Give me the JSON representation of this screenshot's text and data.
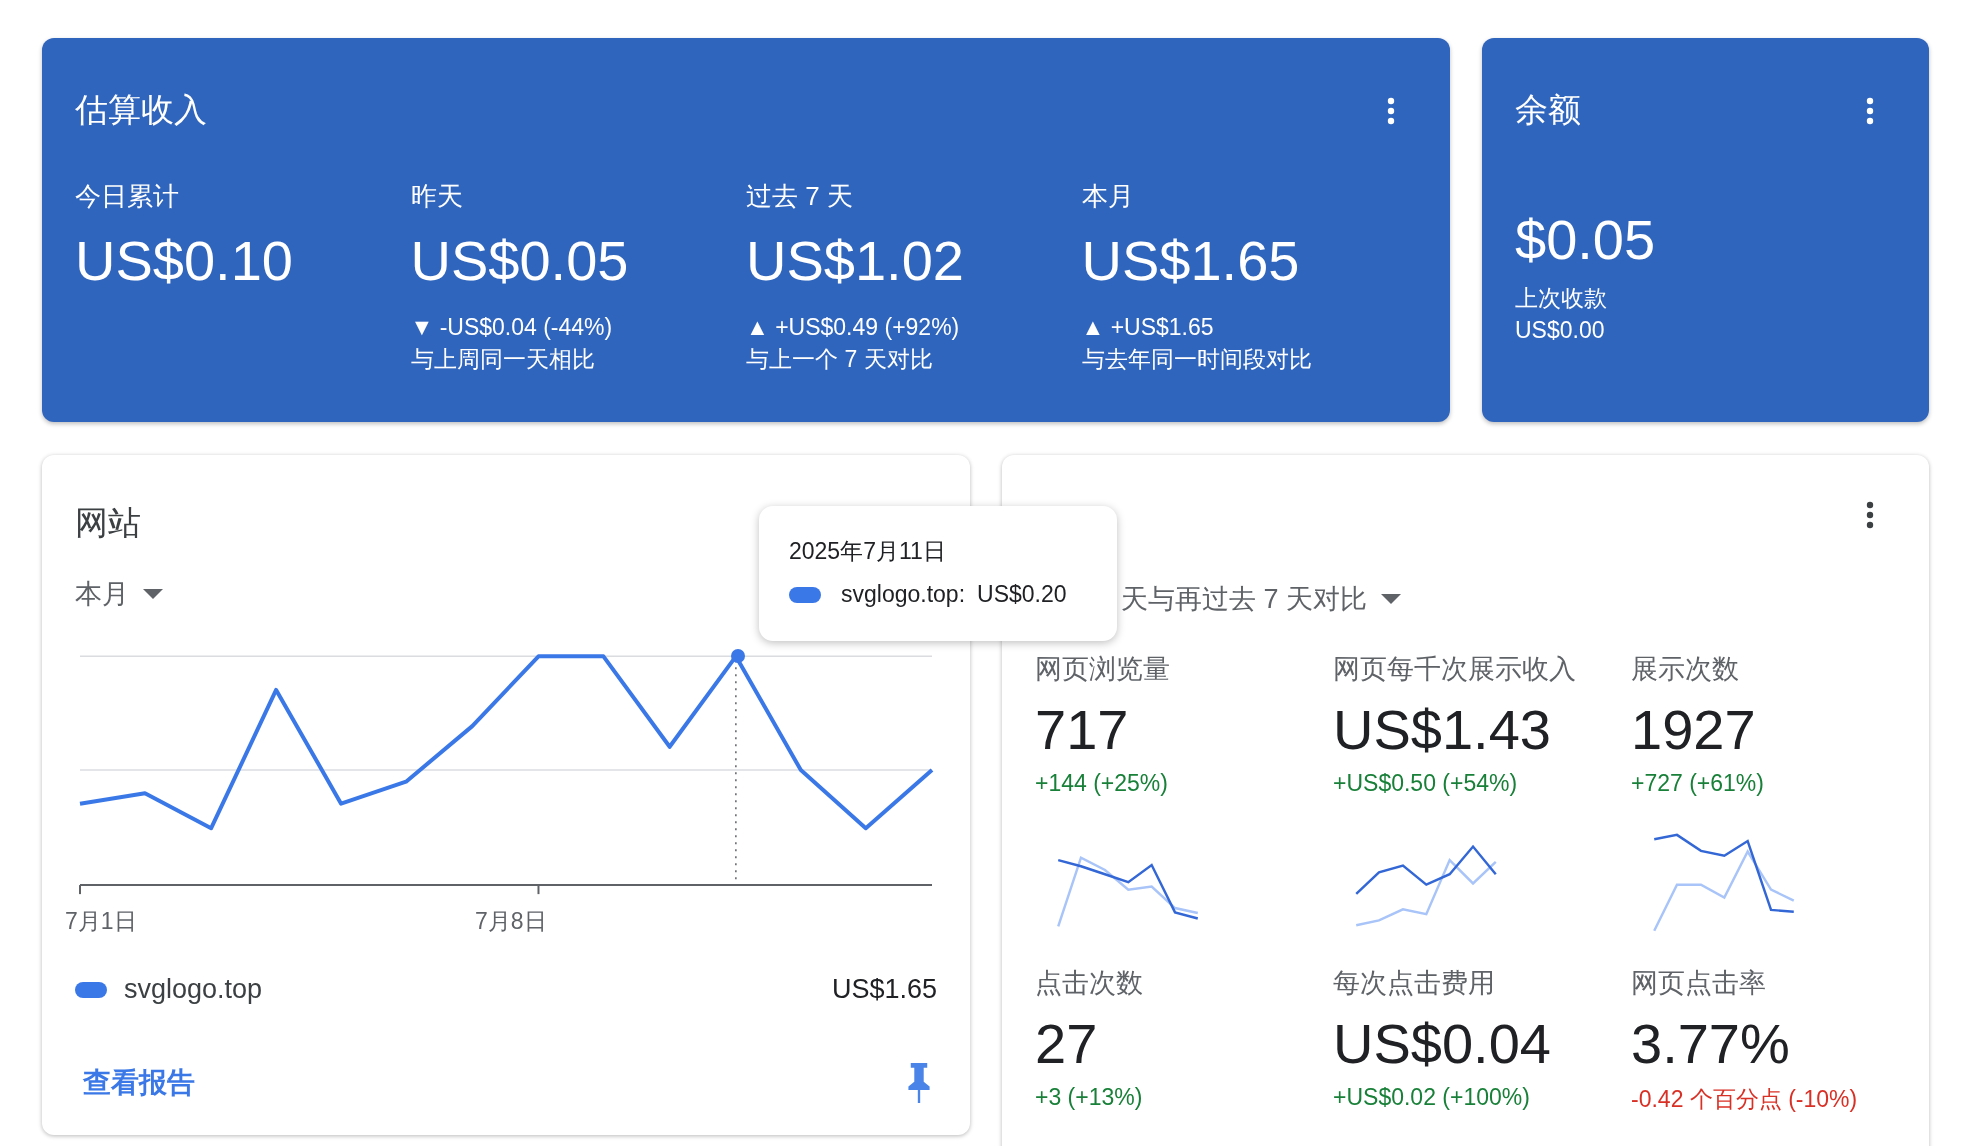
{
  "estimated_earnings": {
    "title": "估算收入",
    "stats": [
      {
        "label": "今日累计",
        "value": "US$0.10"
      },
      {
        "label": "昨天",
        "value": "US$0.05",
        "change": "▼ -US$0.04 (-44%)",
        "comparison": "与上周同一天相比"
      },
      {
        "label": "过去 7 天",
        "value": "US$1.02",
        "change": "▲ +US$0.49 (+92%)",
        "comparison": "与上一个 7 天对比"
      },
      {
        "label": "本月",
        "value": "US$1.65",
        "change": "▲ +US$1.65",
        "comparison": "与去年同一时间段对比"
      }
    ]
  },
  "balance": {
    "title": "余额",
    "value": "$0.05",
    "last_payment_label": "上次收款",
    "last_payment_value": "US$0.00"
  },
  "sites": {
    "title": "网站",
    "period": "本月",
    "x_labels": [
      "7月1日",
      "7月8日"
    ],
    "legend": {
      "name": "svglogo.top",
      "value": "US$1.65"
    },
    "link": "查看报告"
  },
  "tooltip": {
    "date": "2025年7月11日",
    "series": "svglogo.top:",
    "value": "US$0.20"
  },
  "performance": {
    "comparison": "天与再过去 7 天对比",
    "metrics": [
      {
        "label": "网页浏览量",
        "value": "717",
        "change": "+144 (+25%)",
        "color": "#188038"
      },
      {
        "label": "网页每千次展示收入",
        "value": "US$1.43",
        "change": "+US$0.50 (+54%)",
        "color": "#188038"
      },
      {
        "label": "展示次数",
        "value": "1927",
        "change": "+727 (+61%)",
        "color": "#188038"
      },
      {
        "label": "点击次数",
        "value": "27",
        "change": "+3 (+13%)",
        "color": "#188038"
      },
      {
        "label": "每次点击费用",
        "value": "US$0.04",
        "change": "+US$0.02 (+100%)",
        "color": "#188038"
      },
      {
        "label": "网页点击率",
        "value": "3.77%",
        "change": "-0.42 个百分点 (-10%)",
        "color": "#d93025"
      }
    ]
  }
}
